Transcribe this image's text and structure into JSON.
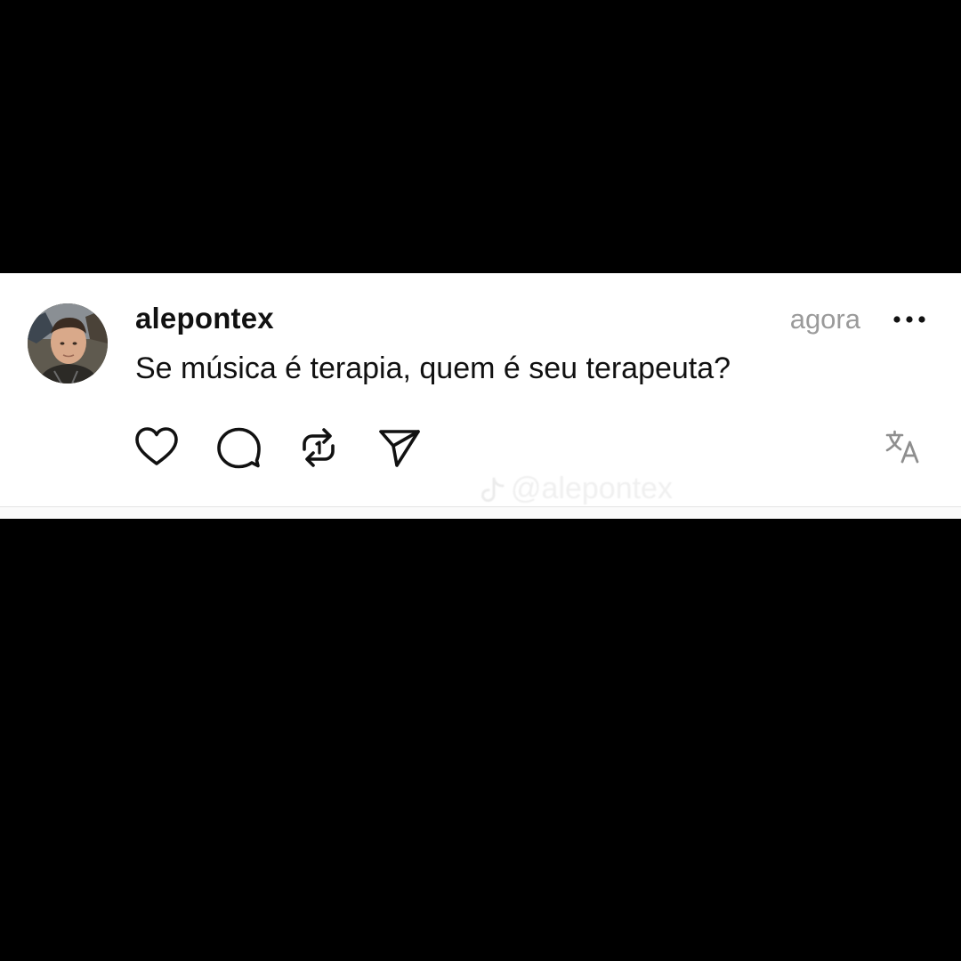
{
  "post": {
    "username": "alepontex",
    "timestamp": "agora",
    "text": "Se música é terapia, quem é seu terapeuta?",
    "watermark": "@alepontex"
  },
  "icons": {
    "avatar": "profile-photo",
    "more": "more-horizontal-icon",
    "like": "heart-icon",
    "comment": "comment-bubble-icon",
    "repost": "repost-icon",
    "share": "send-icon",
    "translate": "translate-icon",
    "watermark_logo": "tiktok-logo"
  },
  "colors": {
    "background": "#000000",
    "card": "#ffffff",
    "text": "#111111",
    "muted": "#9a9a9a"
  }
}
